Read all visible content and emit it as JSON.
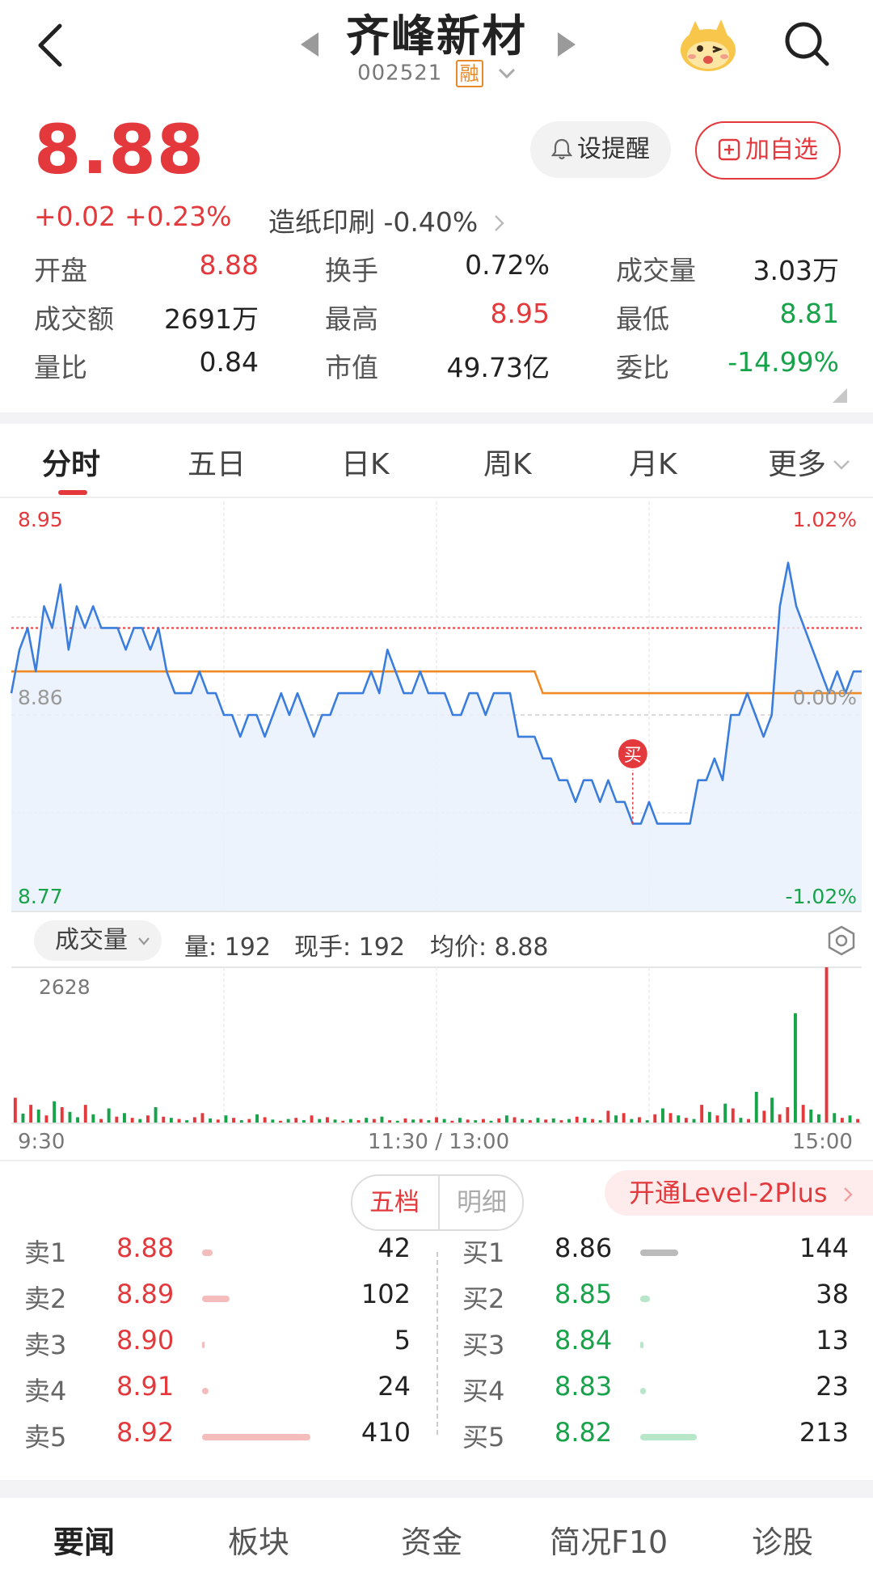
{
  "header": {
    "title": "齐峰新材",
    "code": "002521",
    "margin_badge": "融",
    "icons": [
      "back-icon",
      "prev-stock-icon",
      "next-stock-icon",
      "mascot-icon",
      "search-icon"
    ]
  },
  "quote": {
    "price": "8.88",
    "change": "+0.02",
    "change_pct": "+0.23%",
    "sector": "造纸印刷",
    "sector_pct": "-0.40%",
    "remind_label": "设提醒",
    "add_label": "加自选"
  },
  "stats": [
    {
      "label": "开盘",
      "value": "8.88",
      "color": "red"
    },
    {
      "label": "换手",
      "value": "0.72%",
      "color": "dark"
    },
    {
      "label": "成交量",
      "value": "3.03万",
      "color": "dark"
    },
    {
      "label": "成交额",
      "value": "2691万",
      "color": "dark"
    },
    {
      "label": "最高",
      "value": "8.95",
      "color": "red"
    },
    {
      "label": "最低",
      "value": "8.81",
      "color": "green"
    },
    {
      "label": "量比",
      "value": "0.84",
      "color": "dark"
    },
    {
      "label": "市值",
      "value": "49.73亿",
      "color": "dark"
    },
    {
      "label": "委比",
      "value": "-14.99%",
      "color": "green"
    }
  ],
  "tabs": [
    "分时",
    "五日",
    "日K",
    "周K",
    "月K",
    "更多"
  ],
  "active_tab": "分时",
  "colors": {
    "up": "#e4393c",
    "down": "#16a34a",
    "price_line": "#3b7ddd",
    "avg_line": "#f08a24"
  },
  "chart_data": [
    {
      "type": "line",
      "title": "",
      "y_left_labels": [
        "8.95",
        "8.86",
        "8.77"
      ],
      "y_right_labels": [
        "1.02%",
        "0.00%",
        "-1.02%"
      ],
      "ylim": [
        8.77,
        8.95
      ],
      "x_ticks": [
        "9:30",
        "11:30 / 13:00",
        "15:00"
      ],
      "buy_marker": "买",
      "grid": true,
      "series": [
        {
          "key": "price",
          "values": [
            8.87,
            8.89,
            8.9,
            8.88,
            8.91,
            8.9,
            8.92,
            8.89,
            8.91,
            8.9,
            8.91,
            8.9,
            8.9,
            8.9,
            8.89,
            8.9,
            8.9,
            8.89,
            8.9,
            8.88,
            8.87,
            8.87,
            8.87,
            8.88,
            8.87,
            8.87,
            8.86,
            8.86,
            8.85,
            8.86,
            8.86,
            8.85,
            8.86,
            8.87,
            8.86,
            8.87,
            8.86,
            8.85,
            8.86,
            8.86,
            8.87,
            8.87,
            8.87,
            8.87,
            8.88,
            8.87,
            8.89,
            8.88,
            8.87,
            8.87,
            8.88,
            8.87,
            8.87,
            8.87,
            8.86,
            8.86,
            8.87,
            8.87,
            8.86,
            8.87,
            8.87,
            8.87,
            8.85,
            8.85,
            8.85,
            8.84,
            8.84,
            8.83,
            8.83,
            8.82,
            8.83,
            8.83,
            8.82,
            8.83,
            8.82,
            8.82,
            8.81,
            8.81,
            8.82,
            8.81,
            8.81,
            8.81,
            8.81,
            8.81,
            8.83,
            8.83,
            8.84,
            8.83,
            8.86,
            8.86,
            8.87,
            8.86,
            8.85,
            8.86,
            8.91,
            8.93,
            8.91,
            8.9,
            8.89,
            8.88,
            8.87,
            8.88,
            8.87,
            8.88,
            8.88
          ]
        },
        {
          "key": "avg",
          "values": [
            8.88,
            8.88,
            8.88,
            8.88,
            8.88,
            8.88,
            8.88,
            8.88,
            8.88,
            8.88,
            8.88,
            8.88,
            8.88,
            8.88,
            8.88,
            8.88,
            8.88,
            8.88,
            8.88,
            8.88,
            8.88,
            8.88,
            8.88,
            8.88,
            8.88,
            8.88,
            8.88,
            8.88,
            8.88,
            8.88,
            8.88,
            8.88,
            8.88,
            8.88,
            8.88,
            8.88,
            8.88,
            8.88,
            8.88,
            8.88,
            8.88,
            8.88,
            8.88,
            8.88,
            8.88,
            8.88,
            8.88,
            8.88,
            8.88,
            8.88,
            8.88,
            8.88,
            8.88,
            8.88,
            8.88,
            8.88,
            8.88,
            8.88,
            8.88,
            8.88,
            8.88,
            8.88,
            8.88,
            8.88,
            8.88,
            8.87,
            8.87,
            8.87,
            8.87,
            8.87,
            8.87,
            8.87,
            8.87,
            8.87,
            8.87,
            8.87,
            8.87,
            8.87,
            8.87,
            8.87,
            8.87,
            8.87,
            8.87,
            8.87,
            8.87,
            8.87,
            8.87,
            8.87,
            8.87,
            8.87,
            8.87,
            8.87,
            8.87,
            8.87,
            8.87,
            8.87,
            8.87,
            8.87,
            8.87,
            8.87,
            8.87,
            8.87,
            8.87,
            8.87,
            8.87
          ]
        }
      ]
    },
    {
      "type": "bar",
      "title": "成交量",
      "max_label": "2628",
      "ylim": [
        0,
        2628
      ],
      "values": [
        420,
        150,
        300,
        220,
        120,
        360,
        260,
        180,
        90,
        300,
        140,
        60,
        240,
        100,
        160,
        80,
        60,
        120,
        260,
        100,
        80,
        60,
        40,
        90,
        160,
        70,
        50,
        120,
        80,
        40,
        60,
        140,
        90,
        50,
        30,
        60,
        80,
        40,
        120,
        60,
        90,
        50,
        30,
        60,
        40,
        80,
        60,
        100,
        40,
        30,
        70,
        50,
        60,
        40,
        90,
        60,
        30,
        80,
        50,
        40,
        60,
        30,
        70,
        120,
        90,
        60,
        40,
        80,
        50,
        70,
        40,
        60,
        100,
        80,
        60,
        40,
        200,
        120,
        160,
        60,
        90,
        40,
        140,
        240,
        160,
        120,
        80,
        60,
        300,
        180,
        120,
        320,
        240,
        80,
        60,
        520,
        200,
        420,
        140,
        260,
        1850,
        300,
        220,
        140,
        2628,
        160,
        80,
        120,
        60
      ],
      "colors": [
        "r",
        "g",
        "r",
        "g",
        "r",
        "g",
        "r",
        "g",
        "g",
        "r",
        "g",
        "r",
        "g",
        "r",
        "g",
        "r",
        "g",
        "r",
        "g",
        "r",
        "g",
        "r",
        "g",
        "r",
        "r",
        "g",
        "r",
        "g",
        "r",
        "g",
        "r",
        "g",
        "r",
        "g",
        "r",
        "g",
        "r",
        "g",
        "r",
        "g",
        "r",
        "g",
        "r",
        "g",
        "r",
        "g",
        "r",
        "g",
        "r",
        "g",
        "r",
        "g",
        "r",
        "g",
        "r",
        "g",
        "r",
        "g",
        "r",
        "g",
        "r",
        "g",
        "r",
        "g",
        "r",
        "g",
        "r",
        "g",
        "r",
        "g",
        "r",
        "g",
        "r",
        "g",
        "r",
        "g",
        "r",
        "g",
        "r",
        "g",
        "r",
        "g",
        "r",
        "g",
        "r",
        "g",
        "r",
        "g",
        "r",
        "g",
        "r",
        "g",
        "r",
        "g",
        "r",
        "g",
        "r",
        "g",
        "r",
        "r",
        "g",
        "r",
        "g",
        "g",
        "r",
        "g",
        "r",
        "g",
        "r"
      ]
    }
  ],
  "volume": {
    "selector_label": "成交量",
    "info": [
      "量: 192",
      "现手: 192",
      "均价: 8.88"
    ]
  },
  "orderbook": {
    "seg": [
      "五档",
      "明细"
    ],
    "level2_label": "开通Level-2Plus",
    "asks": [
      {
        "label": "卖1",
        "price": "8.88",
        "qty": "42",
        "ratio": 0.1
      },
      {
        "label": "卖2",
        "price": "8.89",
        "qty": "102",
        "ratio": 0.25
      },
      {
        "label": "卖3",
        "price": "8.90",
        "qty": "5",
        "ratio": 0.01
      },
      {
        "label": "卖4",
        "price": "8.91",
        "qty": "24",
        "ratio": 0.06
      },
      {
        "label": "卖5",
        "price": "8.92",
        "qty": "410",
        "ratio": 1.0
      }
    ],
    "bids": [
      {
        "label": "买1",
        "price": "8.86",
        "qty": "144",
        "ratio": 0.35,
        "bar_color": "#bbbbbb"
      },
      {
        "label": "买2",
        "price": "8.85",
        "qty": "38",
        "ratio": 0.09,
        "bar_color": "#b8e6c9"
      },
      {
        "label": "买3",
        "price": "8.84",
        "qty": "13",
        "ratio": 0.03,
        "bar_color": "#b8e6c9"
      },
      {
        "label": "买4",
        "price": "8.83",
        "qty": "23",
        "ratio": 0.05,
        "bar_color": "#b8e6c9"
      },
      {
        "label": "买5",
        "price": "8.82",
        "qty": "213",
        "ratio": 0.52,
        "bar_color": "#b8e6c9"
      }
    ]
  },
  "bottom_tabs": [
    "要闻",
    "板块",
    "资金",
    "简况F10",
    "诊股"
  ],
  "bottom_active": "要闻"
}
